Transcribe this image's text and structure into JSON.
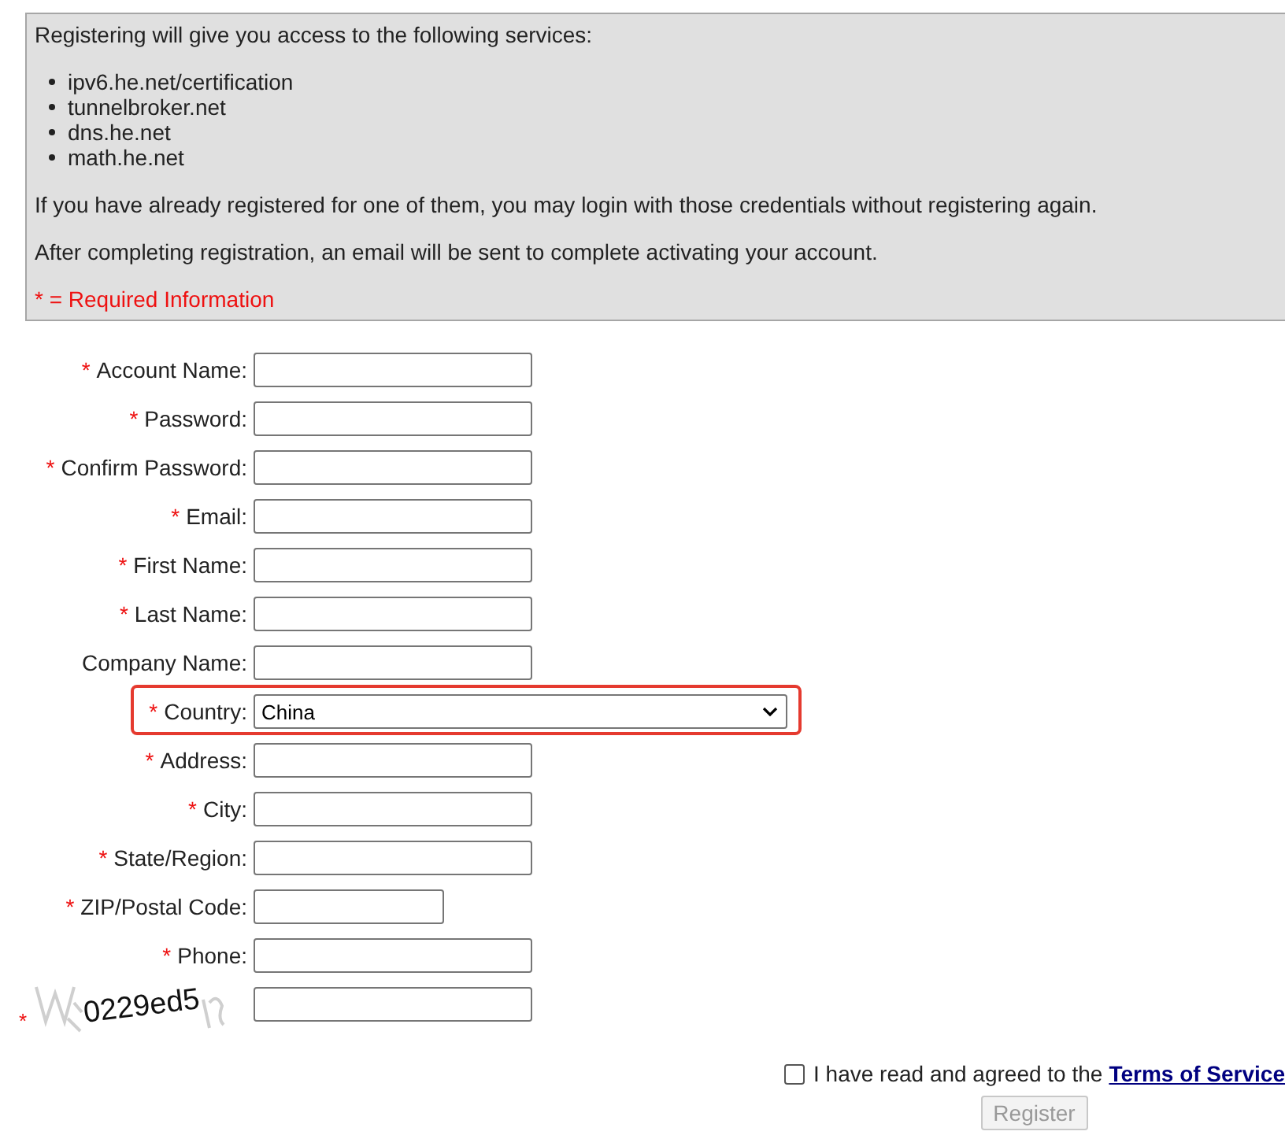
{
  "intro": {
    "heading": "Registering will give you access to the following services:",
    "services": [
      "ipv6.he.net/certification",
      "tunnelbroker.net",
      "dns.he.net",
      "math.he.net"
    ],
    "paragraphs": [
      "If you have already registered for one of them, you may login with those credentials without registering again.",
      "After completing registration, an email will be sent to complete activating your account."
    ],
    "required_note": "* = Required Information"
  },
  "fields": [
    {
      "kind": "text",
      "marker": "*",
      "label": "Account Name:"
    },
    {
      "kind": "text",
      "marker": "*",
      "label": "Password:"
    },
    {
      "kind": "text",
      "marker": "*",
      "label": "Confirm Password:"
    },
    {
      "kind": "text",
      "marker": "*",
      "label": "Email:"
    },
    {
      "kind": "text",
      "marker": "*",
      "label": "First Name:"
    },
    {
      "kind": "text",
      "marker": "*",
      "label": "Last Name:"
    },
    {
      "kind": "text",
      "label": "Company Name:"
    },
    {
      "kind": "select",
      "marker": "*",
      "label": "Country:",
      "value": "China",
      "highlighted": true
    },
    {
      "kind": "text",
      "marker": "*",
      "label": "Address:"
    },
    {
      "kind": "text",
      "marker": "*",
      "label": "City:"
    },
    {
      "kind": "text",
      "marker": "*",
      "label": "State/Region:"
    },
    {
      "kind": "short",
      "marker": "*",
      "label": "ZIP/Postal Code:"
    },
    {
      "kind": "text",
      "marker": "*",
      "label": "Phone:"
    },
    {
      "kind": "captcha",
      "marker": "*",
      "code": "0229ed5"
    }
  ],
  "agreement": {
    "checked": false,
    "text": "I have read and agreed to the",
    "link": "Terms of Service"
  },
  "register_button": {
    "label": "Register",
    "disabled": true
  }
}
